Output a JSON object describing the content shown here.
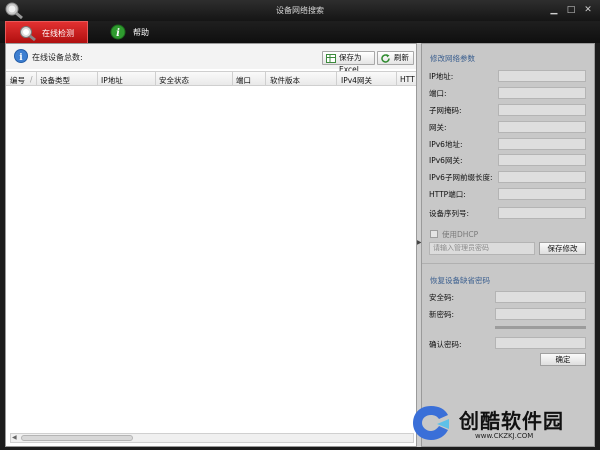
{
  "window": {
    "title": "设备网络搜索",
    "minimize": "▁",
    "maximize": "□",
    "close": "✕"
  },
  "tabs": [
    {
      "label": "在线检测",
      "icon": "magnifier-icon",
      "active": true
    },
    {
      "label": "帮助",
      "icon": "info-icon",
      "active": false
    }
  ],
  "device_panel": {
    "count_label": "在线设备总数:",
    "save_excel_label": "保存为Excel",
    "refresh_label": "刷新",
    "columns": [
      "编号",
      "设备类型",
      "IP地址",
      "安全状态",
      "端口",
      "软件版本",
      "IPv4网关",
      "HTT"
    ],
    "sort_indicator": "/"
  },
  "network_params": {
    "section_title": "修改网络参数",
    "fields": [
      "IP地址:",
      "端口:",
      "子网掩码:",
      "网关:",
      "IPv6地址:",
      "IPv6网关:",
      "IPv6子网前缀长度:",
      "HTTP端口:",
      "设备序列号:"
    ],
    "dhcp_label": "使用DHCP",
    "admin_password_placeholder": "请输入管理员密码",
    "save_label": "保存修改"
  },
  "restore": {
    "section_title": "恢复设备缺省密码",
    "fields": [
      "安全码:",
      "新密码:",
      "确认密码:"
    ],
    "ok_label": "确定"
  },
  "watermark": {
    "name": "创酷软件园",
    "url": "www.CKZKJ.COM"
  },
  "colors": {
    "tab_active": "#c81a1a",
    "section_title": "#3b5f8f",
    "watermark_blue": "#3a6fd8"
  }
}
